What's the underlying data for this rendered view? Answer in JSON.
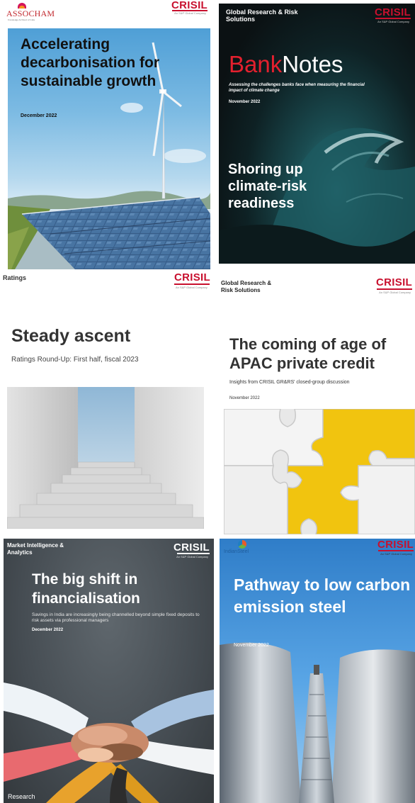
{
  "cards": {
    "decarb": {
      "logo": "ASSOCHAM",
      "logo_tag": "Knowledge Architect of India",
      "brand": "CRISIL",
      "brand_sub": "An S&P Global Company",
      "title": "Accelerating decarbonisation for sustainable growth",
      "date": "December 2022"
    },
    "banknotes": {
      "header": "Global Research & Risk Solutions",
      "brand": "CRISIL",
      "brand_sub": "An S&P Global Company",
      "title_a": "Bank",
      "title_b": "Notes",
      "subtitle": "Assessing the challenges banks face when measuring the financial impact of climate change",
      "date": "November 2022",
      "headline": "Shoring up climate-risk readiness"
    },
    "ascent": {
      "header": "Ratings",
      "brand": "CRISIL",
      "brand_sub": "An S&P Global Company",
      "title": "Steady ascent",
      "subtitle": "Ratings Round-Up: First half, fiscal 2023"
    },
    "apac": {
      "header": "Global Research & Risk Solutions",
      "brand": "CRISIL",
      "brand_sub": "An S&P Global Company",
      "title": "The coming of age of APAC private credit",
      "subtitle": "Insights from CRISIL GR&RS' closed-group discussion",
      "date": "November 2022"
    },
    "shift": {
      "header": "Market Intelligence & Analytics",
      "brand": "CRISIL",
      "brand_sub": "An S&P Global Company",
      "title": "The big shift in financialisation",
      "subtitle": "Savings in India are increasingly being channelled beyond simple fixed deposits to risk assets via professional managers",
      "date": "December 2022",
      "footer": "Research"
    },
    "steel": {
      "logo": "IndianSteel",
      "brand": "CRISIL",
      "brand_sub": "An S&P Global Company",
      "title": "Pathway to low carbon emission steel",
      "date": "November 2022"
    }
  },
  "colors": {
    "crisil_red": "#c8102e",
    "bank_red": "#e4202e",
    "puzzle_yellow": "#f1c40f"
  }
}
